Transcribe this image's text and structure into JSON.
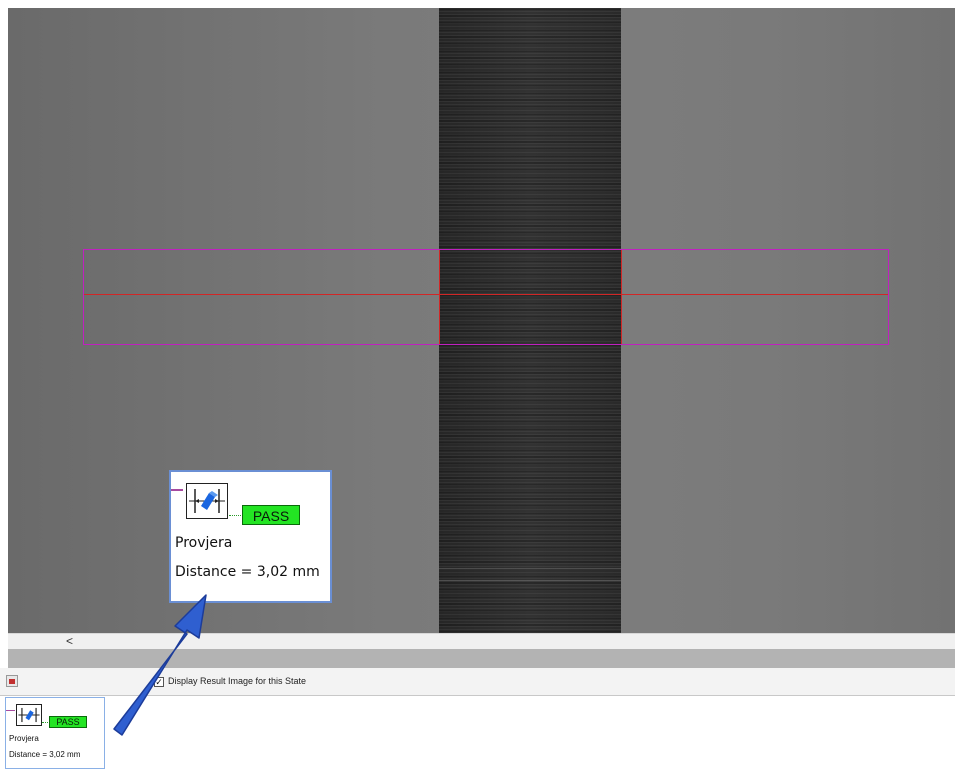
{
  "inspection": {
    "tool_label": "Provjera",
    "status": "PASS",
    "distance_text": "Distance = 3,02 mm"
  },
  "thumbnail": {
    "tool_label": "Provjera",
    "status": "PASS",
    "distance_text": "Distance = 3,02 mm"
  },
  "scrollbar": {
    "left_arrow": "<"
  },
  "options": {
    "display_result_label": "Display Result Image for this State",
    "display_result_checked": "✓"
  },
  "colors": {
    "pass": "#23e423",
    "roi": "#c020c0",
    "measure_line": "#d22626",
    "pointer_arrow": "#2f5fd0",
    "callout_border": "#6a8fd4"
  },
  "icons": {
    "tool": "distance-caliper-icon",
    "toolbar": "result-image-icon",
    "pointer": "blue-arrow-icon"
  }
}
